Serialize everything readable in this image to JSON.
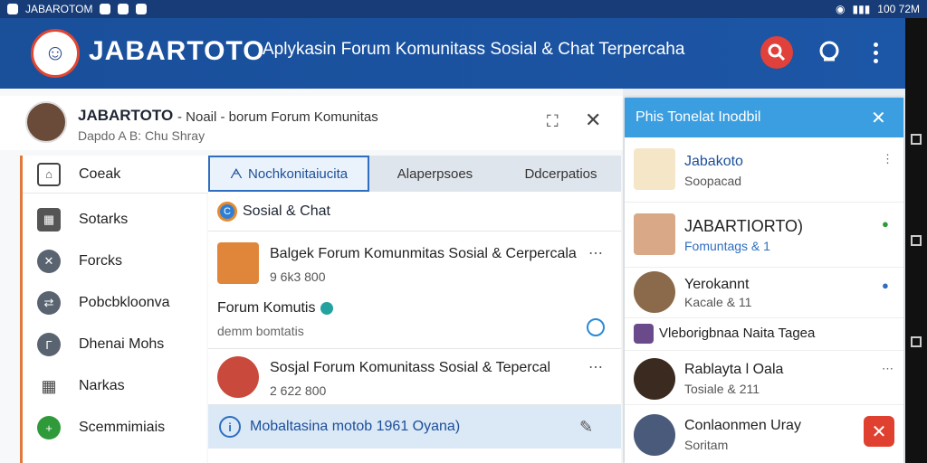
{
  "status_bar": {
    "app_label": "JABAROTOM",
    "time": "100 72M"
  },
  "app": {
    "brand": "JABARTOTO",
    "tagline": "Aplykasin Forum Komunitass Sosial & Chat Terpercaha"
  },
  "header": {
    "title": "JABARTOTO",
    "title_suffix": "- Noail - borum Forum Komunitas",
    "subtitle": "Dapdo A B: Chu Shray"
  },
  "sidebar": {
    "items": [
      {
        "label": "Coeak"
      },
      {
        "label": "Sotarks"
      },
      {
        "label": "Forcks"
      },
      {
        "label": "Pobcbkloonva"
      },
      {
        "label": "Dhenai Mohs"
      },
      {
        "label": "Narkas"
      },
      {
        "label": "Scemmimiais"
      }
    ]
  },
  "tabs": [
    {
      "label": "Nochkonitaiucita"
    },
    {
      "label": "Alaperpsoes"
    },
    {
      "label": "Ddcerpatios"
    }
  ],
  "section": {
    "label": "Sosial & Chat"
  },
  "posts": [
    {
      "title": "Balgek Forum Komunmitas Sosial & Cerpercala",
      "meta": "9 6k3 800"
    },
    {
      "title": "Sosjal Forum Komunitass Sosial & Tepercal",
      "meta": "2 622 800"
    }
  ],
  "forum": {
    "title": "Forum Komutis",
    "sub": "demm bomtatis"
  },
  "footer": {
    "label": "Mobaltasina motob 1961 Oyana)"
  },
  "panel": {
    "title": "Phis Tonelat Inodbil",
    "items": [
      {
        "name": "Jabakoto",
        "meta": "Soopacad"
      },
      {
        "name": "JABARTIORTO)",
        "meta": "Fomuntags & 1"
      },
      {
        "name": "Yerokannt",
        "meta": "Kacale & 11"
      },
      {
        "name": "Vleborigbnaa Naita Tagea",
        "meta": ""
      },
      {
        "name": "Rablayta l Oala",
        "meta": "Tosiale & 211"
      },
      {
        "name": "Conlaonmen Uray",
        "meta": "Soritam"
      }
    ]
  }
}
